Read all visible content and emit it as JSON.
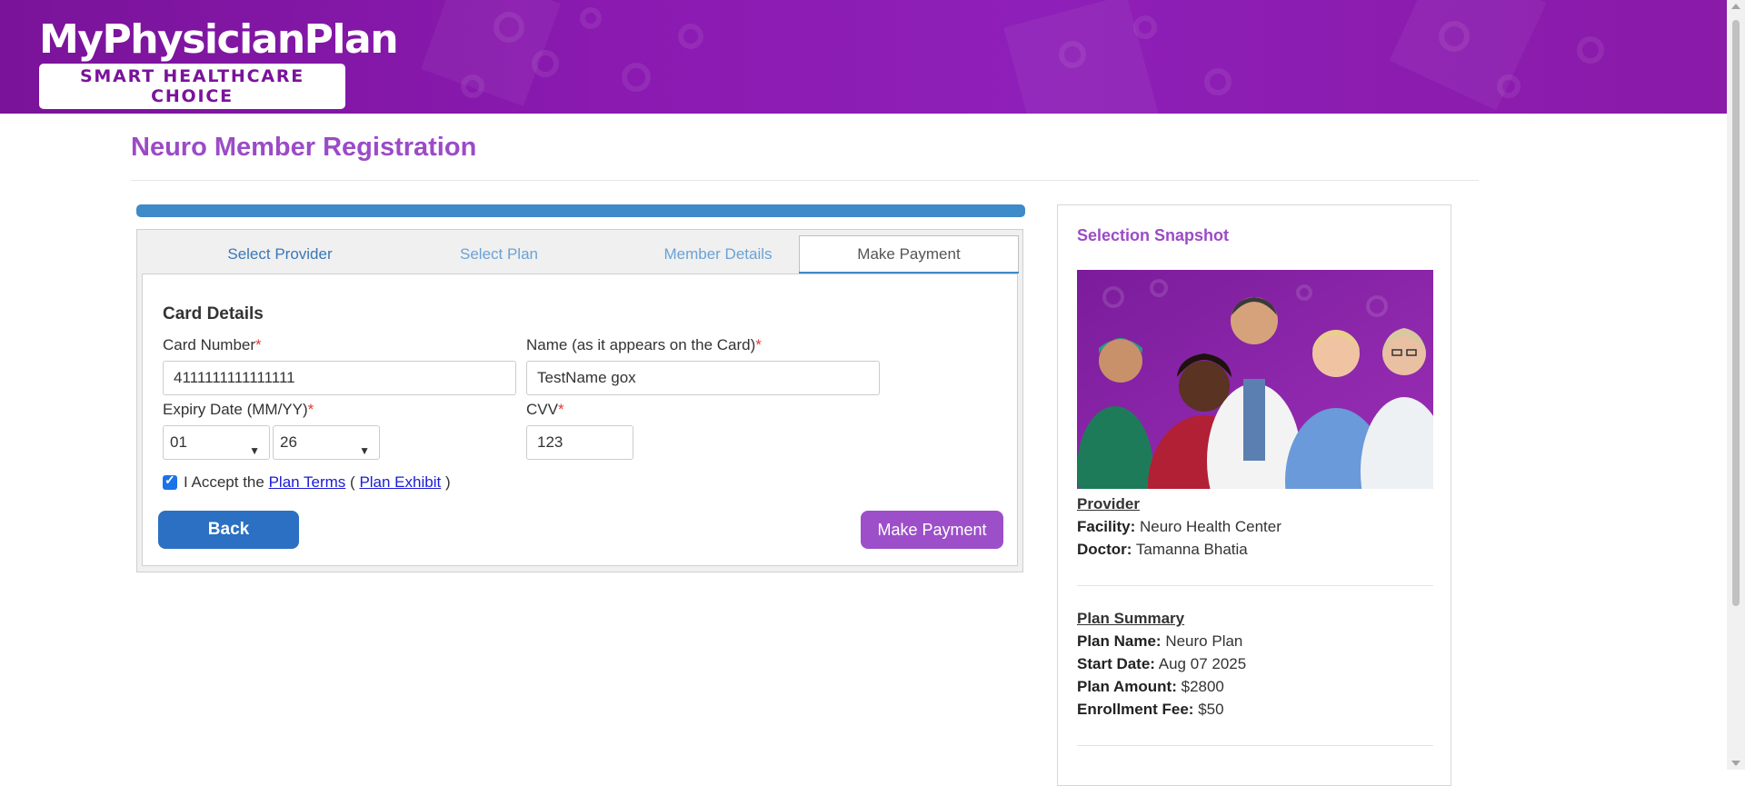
{
  "brand": {
    "name": "MyPhysicianPlan",
    "tagline": "SMART HEALTHCARE CHOICE",
    "header_color": "#8a1ab0"
  },
  "page": {
    "title": "Neuro Member Registration",
    "title_color": "#9b4bc7"
  },
  "wizard": {
    "progress_percent": 100,
    "tabs": [
      {
        "label": "Select Provider",
        "state": "done"
      },
      {
        "label": "Select Plan",
        "state": "done"
      },
      {
        "label": "Member Details",
        "state": "done"
      },
      {
        "label": "Make Payment",
        "state": "active"
      }
    ],
    "card_details": {
      "heading": "Card Details",
      "card_number_label": "Card Number",
      "card_number_value": "4111111111111111",
      "name_label": "Name (as it appears on the Card)",
      "name_value": "TestName gox",
      "expiry_label": "Expiry Date (MM/YY)",
      "expiry_month": "01",
      "expiry_year": "26",
      "cvv_label": "CVV",
      "cvv_value": "123",
      "required_mark": "*",
      "accept_checked": true,
      "accept_prefix": "I Accept the",
      "plan_terms_link": "Plan Terms",
      "paren_open": "(",
      "plan_exhibit_link": "Plan Exhibit",
      "paren_close": ")"
    },
    "buttons": {
      "back": "Back",
      "make_payment": "Make Payment"
    }
  },
  "snapshot": {
    "title": "Selection Snapshot",
    "image_alt": "healthcare-team-photo",
    "provider": {
      "heading": "Provider",
      "facility_label": "Facility:",
      "facility_value": "Neuro Health Center",
      "doctor_label": "Doctor:",
      "doctor_value": "Tamanna Bhatia"
    },
    "plan_summary": {
      "heading": "Plan Summary",
      "plan_name_label": "Plan Name:",
      "plan_name_value": "Neuro Plan",
      "start_date_label": "Start Date:",
      "start_date_value": "Aug 07 2025",
      "plan_amount_label": "Plan Amount:",
      "plan_amount_value": "$2800",
      "enrollment_fee_label": "Enrollment Fee:",
      "enrollment_fee_value": "$50"
    }
  }
}
